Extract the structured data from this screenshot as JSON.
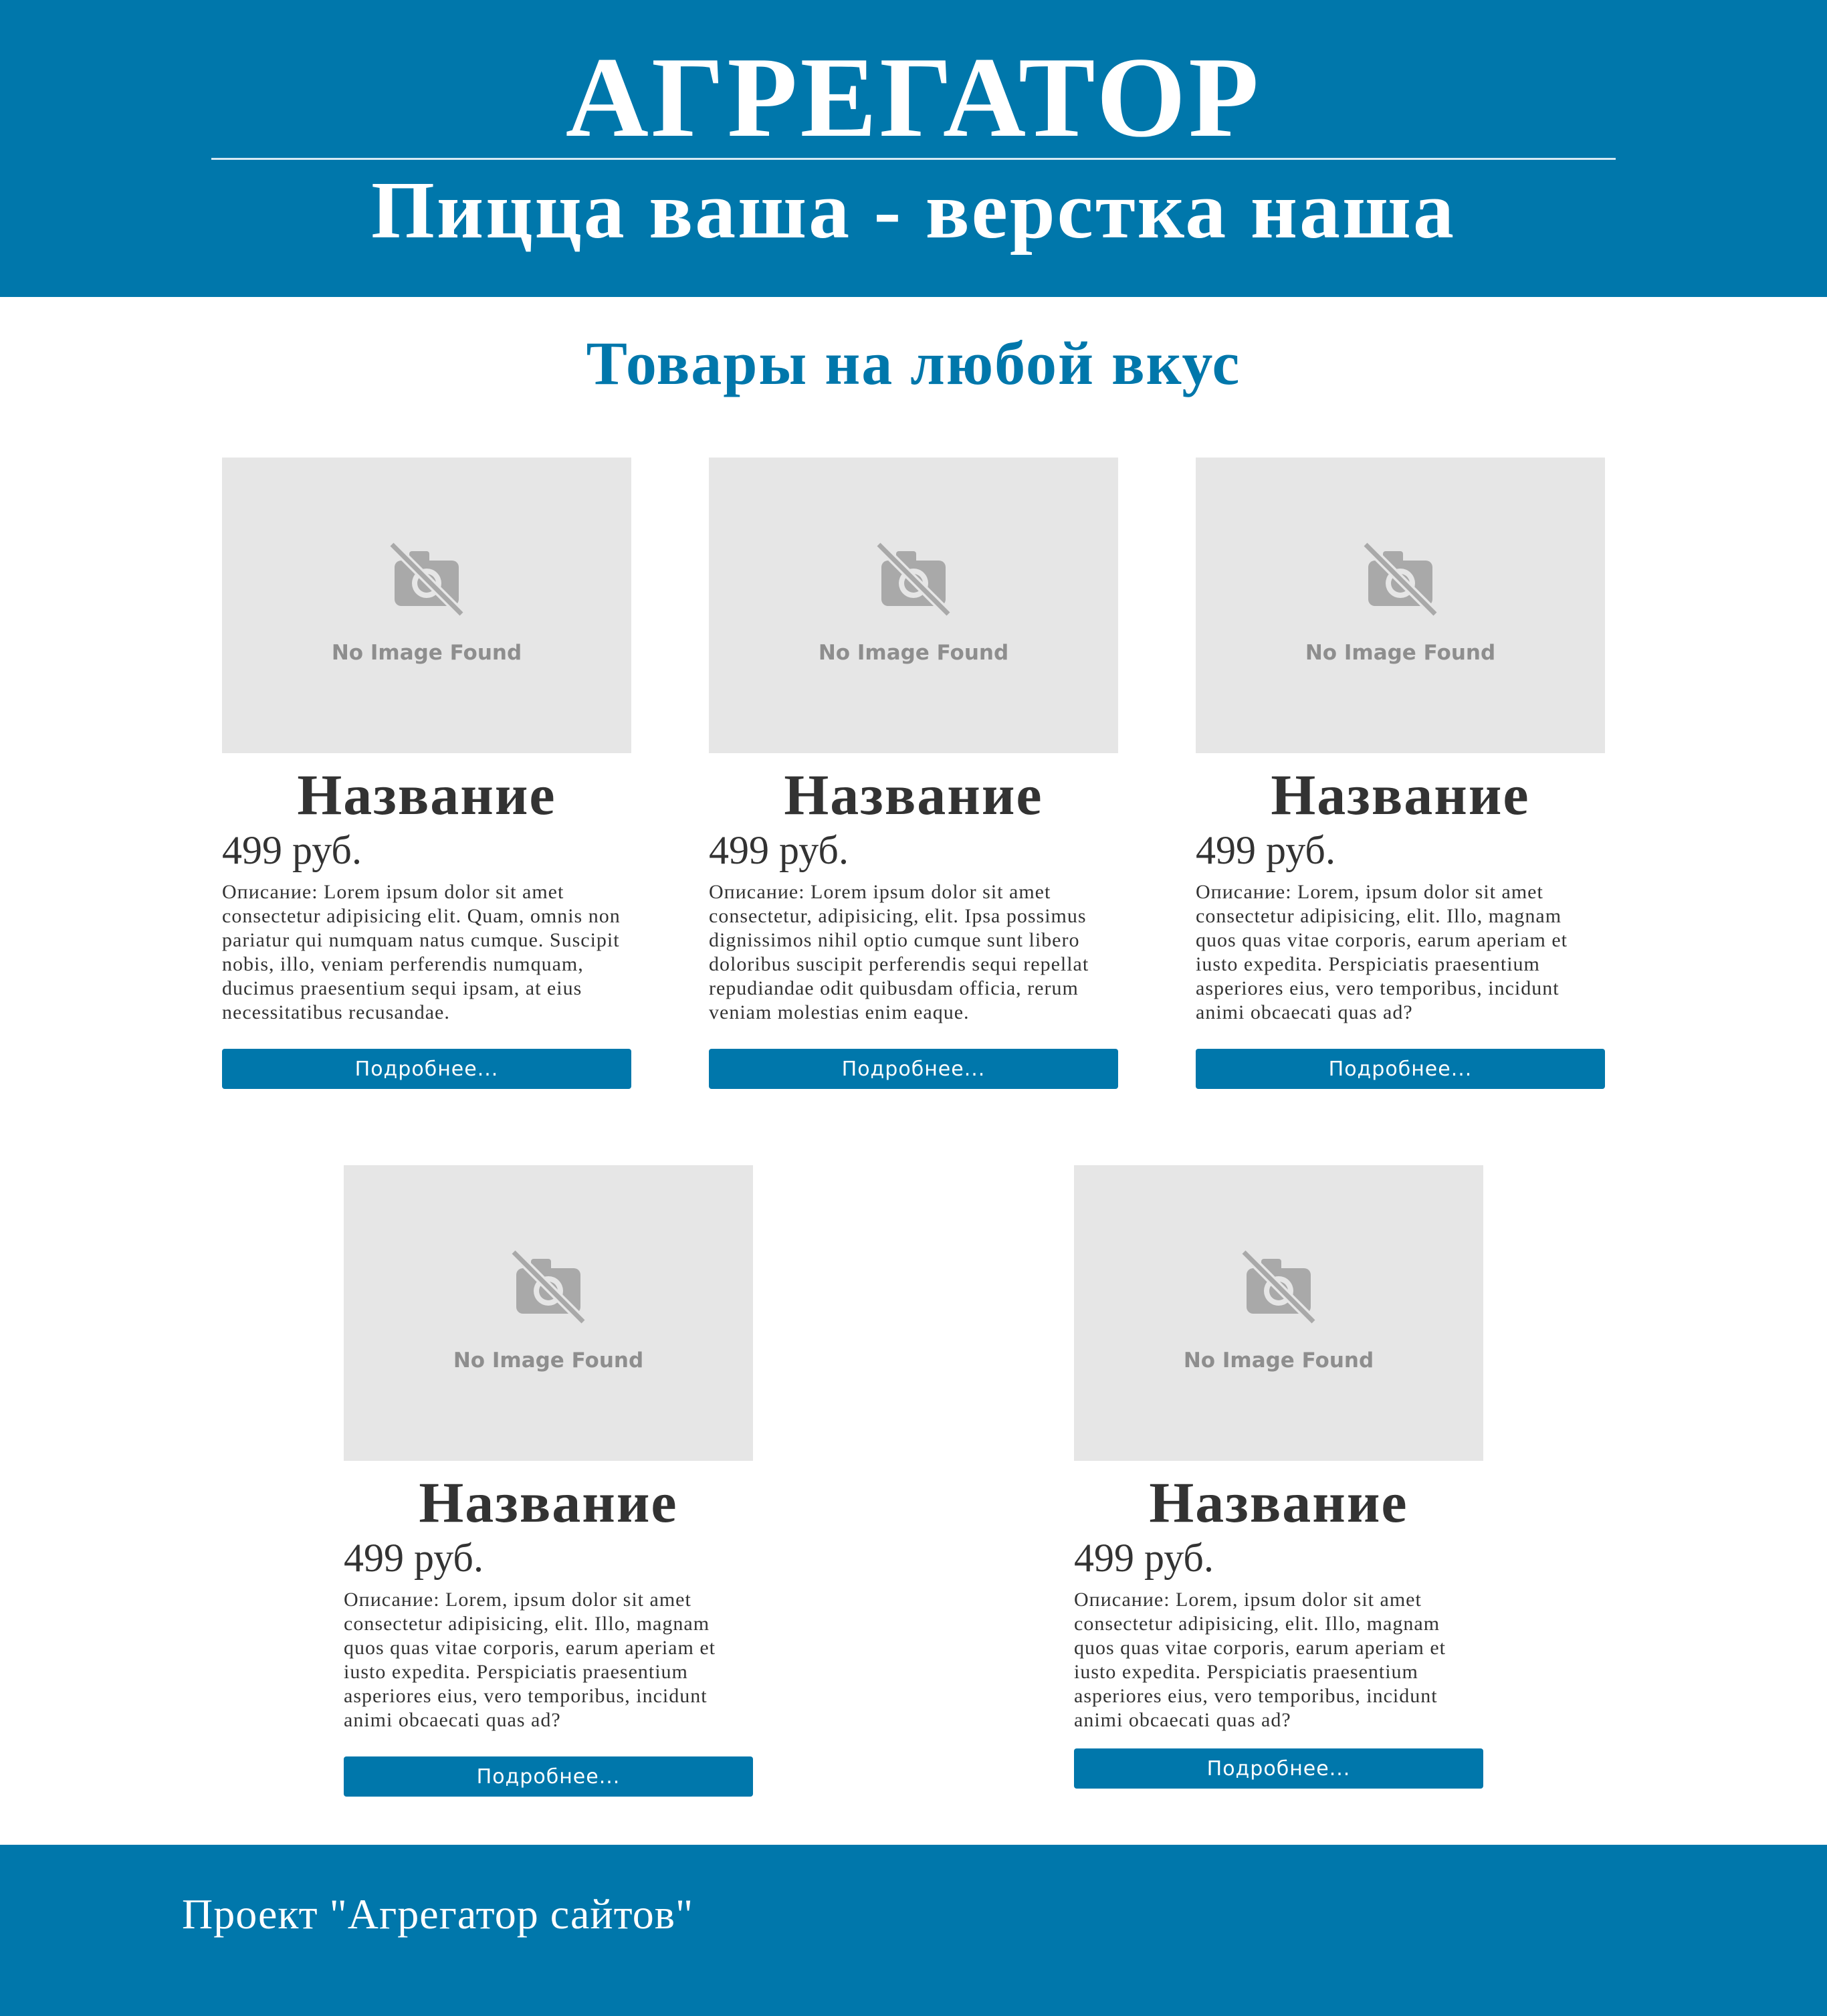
{
  "header": {
    "title": "АГРЕГАТОР",
    "subtitle": "Пицца ваша - верстка наша"
  },
  "main": {
    "heading": "Товары на любой вкус",
    "products": [
      {
        "image_text": "No Image Found",
        "image_icon": "camera-off-icon",
        "title": "Название",
        "price": "499 руб.",
        "description": "Описание: Lorem ipsum dolor sit amet consectetur adipisicing elit. Quam, omnis non pariatur qui numquam natus cumque. Suscipit nobis, illo, veniam perferendis numquam, ducimus praesentium sequi ipsam, at eius necessitatibus recusandae.",
        "button_label": "Подробнее..."
      },
      {
        "image_text": "No Image Found",
        "image_icon": "camera-off-icon",
        "title": "Название",
        "price": "499 руб.",
        "description": "Описание: Lorem ipsum dolor sit amet consectetur, adipisicing, elit. Ipsa possimus dignissimos nihil optio cumque sunt libero doloribus suscipit perferendis sequi repellat repudiandae odit quibusdam officia, rerum veniam molestias enim eaque.",
        "button_label": "Подробнее..."
      },
      {
        "image_text": "No Image Found",
        "image_icon": "camera-off-icon",
        "title": "Название",
        "price": "499 руб.",
        "description": "Описание: Lorem, ipsum dolor sit amet consectetur adipisicing, elit. Illo, magnam quos quas vitae corporis, earum aperiam et iusto expedita. Perspiciatis praesentium asperiores eius, vero temporibus, incidunt animi obcaecati quas ad?",
        "button_label": "Подробнее..."
      },
      {
        "image_text": "No Image Found",
        "image_icon": "camera-off-icon",
        "title": "Название",
        "price": "499 руб.",
        "description": "Описание: Lorem, ipsum dolor sit amet consectetur adipisicing, elit. Illo, magnam quos quas vitae corporis, earum aperiam et iusto expedita. Perspiciatis praesentium asperiores eius, vero temporibus, incidunt animi obcaecati quas ad?",
        "button_label": "Подробнее..."
      },
      {
        "image_text": "No Image Found",
        "image_icon": "camera-off-icon",
        "title": "Название",
        "price": "499 руб.",
        "description": "Описание: Lorem, ipsum dolor sit amet consectetur adipisicing, elit. Illo, magnam quos quas vitae corporis, earum aperiam et iusto expedita. Perspiciatis praesentium asperiores eius, vero temporibus, incidunt animi obcaecati quas ad?",
        "button_label": "Подробнее..."
      }
    ]
  },
  "footer": {
    "text": "Проект \"Агрегатор сайтов\""
  },
  "colors": {
    "brand": "#0077ab",
    "image_placeholder": "#e6e6e6",
    "text": "#333333"
  }
}
